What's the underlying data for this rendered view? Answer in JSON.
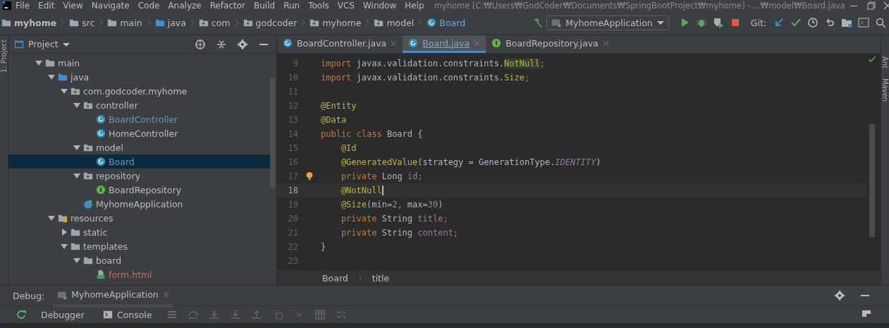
{
  "window": {
    "menu": [
      "File",
      "Edit",
      "View",
      "Navigate",
      "Code",
      "Analyze",
      "Refactor",
      "Build",
      "Run",
      "Tools",
      "VCS",
      "Window",
      "Help"
    ],
    "title": "myhome [C:₩Users₩GodCoder₩Documents₩SpringBootProject₩myhome] - ...₩model₩Board.java"
  },
  "navbar": {
    "crumbs": [
      {
        "label": "myhome",
        "kind": "module"
      },
      {
        "label": "src",
        "kind": "folder"
      },
      {
        "label": "main",
        "kind": "folder"
      },
      {
        "label": "java",
        "kind": "source"
      },
      {
        "label": "com",
        "kind": "package"
      },
      {
        "label": "godcoder",
        "kind": "package"
      },
      {
        "label": "myhome",
        "kind": "package"
      },
      {
        "label": "model",
        "kind": "package"
      },
      {
        "label": "Board",
        "kind": "class"
      }
    ],
    "run_config": "MyhomeApplication",
    "git_label": "Git:"
  },
  "project": {
    "title": "Project",
    "stripe_label": "1: Project",
    "tree": [
      {
        "label": "main",
        "kind": "folder",
        "color": "#bbbbbb",
        "expanded": true,
        "selected": false,
        "children": [
          {
            "label": "java",
            "kind": "source",
            "color": "#bbbbbb",
            "expanded": true,
            "selected": false,
            "children": [
              {
                "label": "com.godcoder.myhome",
                "kind": "package",
                "color": "#bbbbbb",
                "expanded": true,
                "selected": false,
                "children": [
                  {
                    "label": "controller",
                    "kind": "package",
                    "color": "#bbbbbb",
                    "expanded": true,
                    "selected": false,
                    "children": [
                      {
                        "label": "BoardController",
                        "kind": "class",
                        "color": "#6897bb",
                        "selected": false
                      },
                      {
                        "label": "HomeController",
                        "kind": "class",
                        "color": "#bbbbbb",
                        "selected": false
                      }
                    ]
                  },
                  {
                    "label": "model",
                    "kind": "package",
                    "color": "#bbbbbb",
                    "expanded": true,
                    "selected": false,
                    "children": [
                      {
                        "label": "Board",
                        "kind": "class",
                        "color": "#6897bb",
                        "selected": true
                      }
                    ]
                  },
                  {
                    "label": "repository",
                    "kind": "package",
                    "color": "#bbbbbb",
                    "expanded": true,
                    "selected": false,
                    "children": [
                      {
                        "label": "BoardRepository",
                        "kind": "interface",
                        "color": "#bbbbbb",
                        "selected": false
                      }
                    ]
                  },
                  {
                    "label": "MyhomeApplication",
                    "kind": "app",
                    "color": "#bbbbbb",
                    "selected": false
                  }
                ]
              }
            ]
          },
          {
            "label": "resources",
            "kind": "resources",
            "color": "#bbbbbb",
            "expanded": true,
            "selected": false,
            "children": [
              {
                "label": "static",
                "kind": "folder",
                "color": "#bbbbbb",
                "expanded": false,
                "selected": false
              },
              {
                "label": "templates",
                "kind": "folder",
                "color": "#bbbbbb",
                "expanded": true,
                "selected": false,
                "children": [
                  {
                    "label": "board",
                    "kind": "folder",
                    "color": "#bbbbbb",
                    "expanded": true,
                    "selected": false,
                    "children": [
                      {
                        "label": "form.html",
                        "kind": "html",
                        "color": "#d1675a",
                        "selected": false
                      }
                    ]
                  }
                ]
              }
            ]
          }
        ]
      }
    ]
  },
  "editor": {
    "tabs": [
      {
        "label": "BoardController.java",
        "kind": "class",
        "selected": false
      },
      {
        "label": "Board.java",
        "kind": "class",
        "selected": true
      },
      {
        "label": "BoardRepository.java",
        "kind": "interface",
        "selected": false
      }
    ],
    "lines": [
      {
        "number": "9",
        "current": false,
        "tokens": [
          {
            "kind": "keyword",
            "text": "import "
          },
          {
            "kind": "plain",
            "text": "javax.validation.constraints."
          },
          {
            "kind": "highlight",
            "text": "NotNull"
          },
          {
            "kind": "keyword",
            "text": ";"
          }
        ]
      },
      {
        "number": "10",
        "current": false,
        "tokens": [
          {
            "kind": "keyword",
            "text": "import "
          },
          {
            "kind": "plain",
            "text": "javax.validation.constraints."
          },
          {
            "kind": "annotation",
            "text": "Size"
          },
          {
            "kind": "keyword",
            "text": ";"
          }
        ]
      },
      {
        "number": "11",
        "current": false
      },
      {
        "number": "12",
        "current": false,
        "tokens": [
          {
            "kind": "annotation",
            "text": "@Entity"
          }
        ]
      },
      {
        "number": "13",
        "current": false,
        "tokens": [
          {
            "kind": "annotation",
            "text": "@Data"
          }
        ]
      },
      {
        "number": "14",
        "current": false,
        "tokens": [
          {
            "kind": "keyword",
            "text": "public class "
          },
          {
            "kind": "plain",
            "text": "Board {"
          }
        ]
      },
      {
        "number": "15",
        "current": false,
        "tokens": [
          {
            "kind": "annotation",
            "text": "    @Id"
          }
        ]
      },
      {
        "number": "16",
        "current": false,
        "tokens": [
          {
            "kind": "annotation",
            "text": "    @GeneratedValue"
          },
          {
            "kind": "plain",
            "text": "(strategy = GenerationType."
          },
          {
            "kind": "constant",
            "text": "IDENTITY"
          },
          {
            "kind": "plain",
            "text": ")"
          }
        ]
      },
      {
        "number": "17",
        "current": false,
        "bulb": true,
        "tokens": [
          {
            "kind": "keyword",
            "text": "    private "
          },
          {
            "kind": "plain",
            "text": "Long "
          },
          {
            "kind": "field",
            "text": "id"
          },
          {
            "kind": "keyword",
            "text": ";"
          }
        ]
      },
      {
        "number": "18",
        "current": true,
        "tokens": [
          {
            "kind": "annotation",
            "text": "    @NotNull"
          }
        ]
      },
      {
        "number": "19",
        "current": false,
        "tokens": [
          {
            "kind": "annotation",
            "text": "    @Size"
          },
          {
            "kind": "plain",
            "text": "(min="
          },
          {
            "kind": "number",
            "text": "2"
          },
          {
            "kind": "keyword",
            "text": ", "
          },
          {
            "kind": "plain",
            "text": "max="
          },
          {
            "kind": "number",
            "text": "30"
          },
          {
            "kind": "plain",
            "text": ")"
          }
        ]
      },
      {
        "number": "20",
        "current": false,
        "tokens": [
          {
            "kind": "keyword",
            "text": "    private "
          },
          {
            "kind": "plain",
            "text": "String "
          },
          {
            "kind": "field",
            "text": "title"
          },
          {
            "kind": "keyword",
            "text": ";"
          }
        ]
      },
      {
        "number": "21",
        "current": false,
        "tokens": [
          {
            "kind": "keyword",
            "text": "    private "
          },
          {
            "kind": "plain",
            "text": "String "
          },
          {
            "kind": "field",
            "text": "content"
          },
          {
            "kind": "keyword",
            "text": ";"
          }
        ]
      },
      {
        "number": "22",
        "current": false,
        "tokens": [
          {
            "kind": "plain",
            "text": "}"
          }
        ]
      },
      {
        "number": "23",
        "current": false
      }
    ],
    "breadcrumbs": [
      "Board",
      "title"
    ]
  },
  "right_stripe": [
    "Ant",
    "Maven"
  ],
  "debug": {
    "label": "Debug:",
    "session": "MyhomeApplication",
    "tabs": [
      {
        "label": "Debugger",
        "kind": "plain",
        "selected": false
      },
      {
        "label": "Console",
        "kind": "console",
        "selected": false
      }
    ]
  }
}
